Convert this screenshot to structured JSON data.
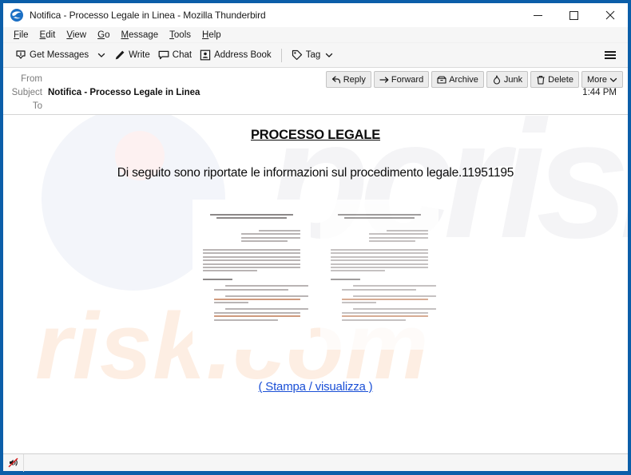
{
  "window": {
    "title": "Notifica - Processo Legale in Linea - Mozilla Thunderbird",
    "app_icon": "thunderbird-icon",
    "controls": {
      "minimize": "minimize-icon",
      "maximize": "maximize-icon",
      "close": "close-icon"
    }
  },
  "menubar": {
    "items": [
      {
        "label": "File",
        "accel": "F"
      },
      {
        "label": "Edit",
        "accel": "E"
      },
      {
        "label": "View",
        "accel": "V"
      },
      {
        "label": "Go",
        "accel": "G"
      },
      {
        "label": "Message",
        "accel": "M"
      },
      {
        "label": "Tools",
        "accel": "T"
      },
      {
        "label": "Help",
        "accel": "H"
      }
    ]
  },
  "toolbar": {
    "get_messages": "Get Messages",
    "write": "Write",
    "chat": "Chat",
    "address_book": "Address Book",
    "tag": "Tag",
    "menu_button": "hamburger-menu-icon"
  },
  "message_header": {
    "from_label": "From",
    "from_value": "",
    "subject_label": "Subject",
    "subject_value": "Notifica - Processo Legale in Linea",
    "to_label": "To",
    "to_value": "",
    "timestamp": "1:44 PM",
    "actions": [
      {
        "label": "Reply",
        "icon": "reply-icon"
      },
      {
        "label": "Forward",
        "icon": "forward-icon"
      },
      {
        "label": "Archive",
        "icon": "archive-icon"
      },
      {
        "label": "Junk",
        "icon": "junk-icon"
      },
      {
        "label": "Delete",
        "icon": "trash-icon"
      },
      {
        "label": "More",
        "icon": "chevron-down-icon"
      }
    ]
  },
  "message_body": {
    "heading": "PROCESSO LEGALE",
    "paragraph": "Di seguito sono riportate le informazioni sul procedimento legale.11951195",
    "link": "( Stampa / visualizza )",
    "watermark_top": "pcrisk",
    "watermark_bottom": "risk.com",
    "attachment_preview_count": 2
  },
  "statusbar": {
    "icon": "sound-muted-icon"
  },
  "colors": {
    "window_frame": "#0b5ea9",
    "toolbar_bg": "#f6f6f6",
    "link": "#1a4fd6",
    "text": "#0c0c0c",
    "label": "#7a7a7a"
  }
}
